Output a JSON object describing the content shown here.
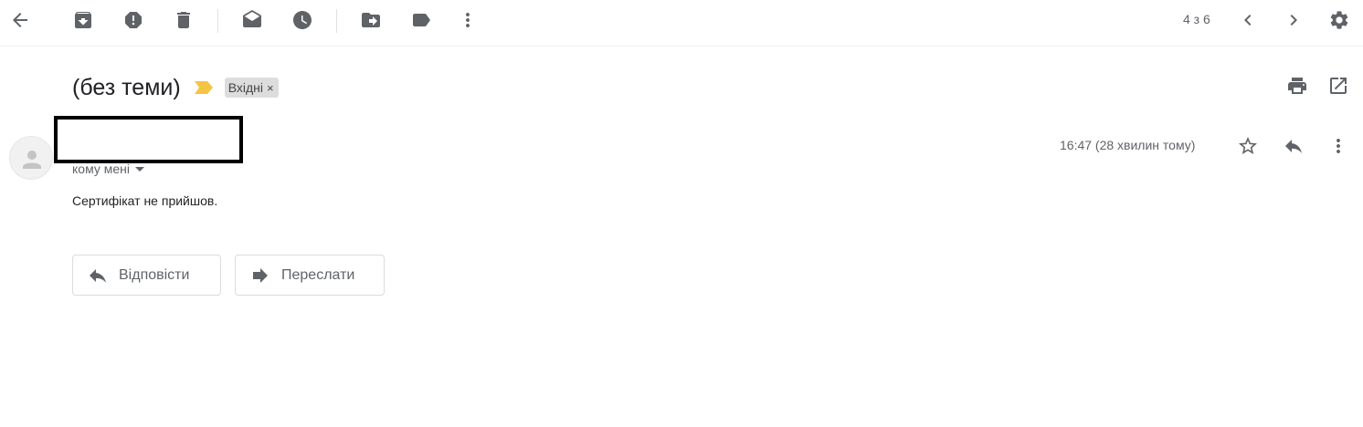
{
  "toolbar": {
    "icons": [
      "back-arrow-icon",
      "archive-icon",
      "report-spam-icon",
      "delete-icon",
      "mark-unread-icon",
      "snooze-icon",
      "move-to-icon",
      "label-icon",
      "more-vert-icon"
    ],
    "pager_text": "4 з 6"
  },
  "subject": {
    "text": "(без теми)",
    "important_color": "#f4c542",
    "label": "Вхідні",
    "label_close": "×"
  },
  "message": {
    "sender": "",
    "to_text": "кому мені",
    "time_text": "16:47 (28 хвилин тому)",
    "body": "Сертифікат не прийшов."
  },
  "actions": {
    "reply_label": "Відповісти",
    "forward_label": "Переслати"
  }
}
